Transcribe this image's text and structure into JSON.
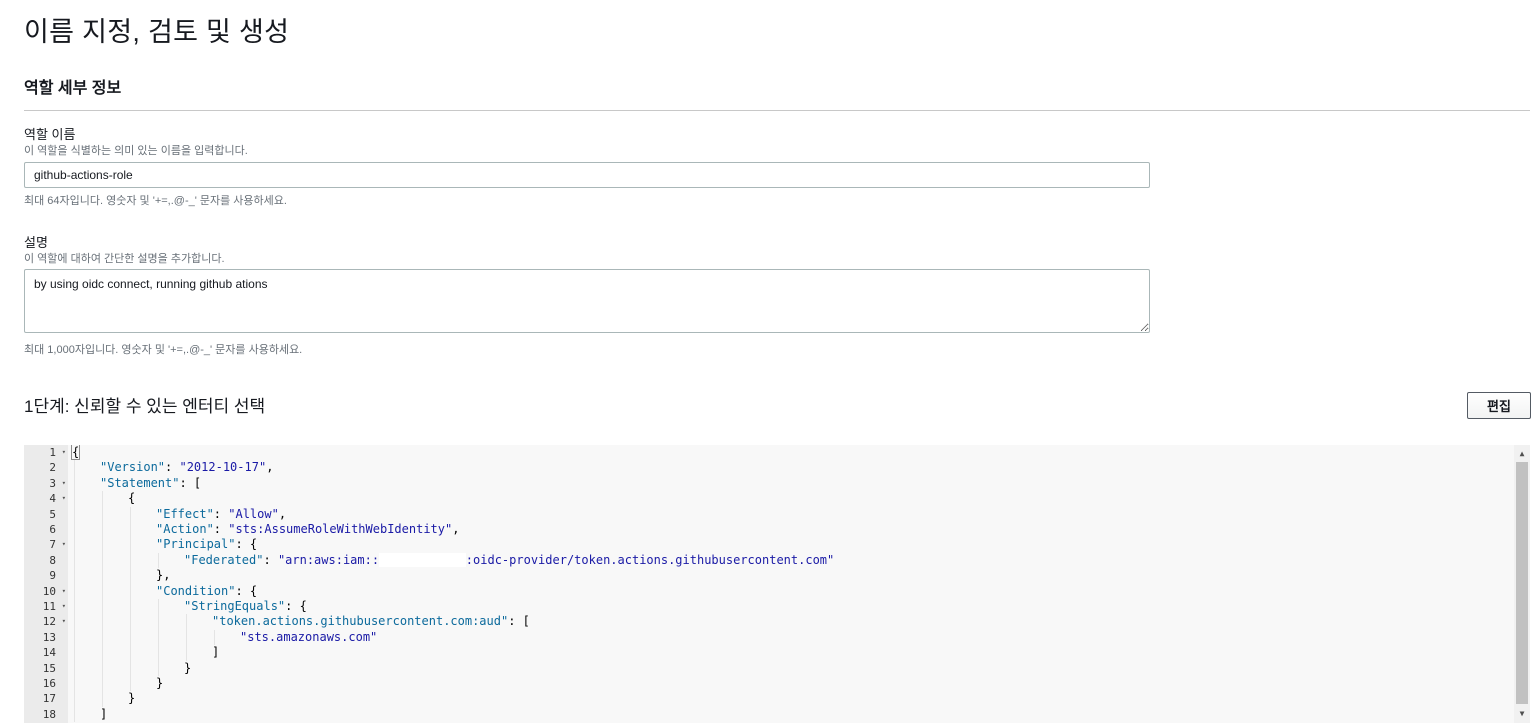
{
  "page": {
    "title": "이름 지정, 검토 및 생성"
  },
  "role_details": {
    "section_title": "역할 세부 정보",
    "name_field": {
      "label": "역할 이름",
      "description": "이 역할을 식별하는 의미 있는 이름을 입력합니다.",
      "value": "github-actions-role",
      "hint": "최대 64자입니다. 영숫자 및 '+=,.@-_' 문자를 사용하세요."
    },
    "description_field": {
      "label": "설명",
      "description": "이 역할에 대하여 간단한 설명을 추가합니다.",
      "value": "by using oidc connect, running github ations",
      "hint": "최대 1,000자입니다. 영숫자 및 '+=,.@-_' 문자를 사용하세요."
    }
  },
  "step1": {
    "title": "1단계: 신뢰할 수 있는 엔터티 선택",
    "edit_label": "편집"
  },
  "editor": {
    "fold_glyph": "▾",
    "scroll_up_glyph": "▲",
    "scroll_down_glyph": "▼",
    "lines": [
      {
        "num": "1",
        "fold": true,
        "indent": 0,
        "tokens": [
          {
            "t": "punc",
            "v": "{"
          }
        ]
      },
      {
        "num": "2",
        "fold": false,
        "indent": 1,
        "tokens": [
          {
            "t": "key",
            "v": "\"Version\""
          },
          {
            "t": "punc",
            "v": ": "
          },
          {
            "t": "str",
            "v": "\"2012-10-17\""
          },
          {
            "t": "punc",
            "v": ","
          }
        ]
      },
      {
        "num": "3",
        "fold": true,
        "indent": 1,
        "tokens": [
          {
            "t": "key",
            "v": "\"Statement\""
          },
          {
            "t": "punc",
            "v": ": ["
          }
        ]
      },
      {
        "num": "4",
        "fold": true,
        "indent": 2,
        "tokens": [
          {
            "t": "punc",
            "v": "{"
          }
        ]
      },
      {
        "num": "5",
        "fold": false,
        "indent": 3,
        "tokens": [
          {
            "t": "key",
            "v": "\"Effect\""
          },
          {
            "t": "punc",
            "v": ": "
          },
          {
            "t": "str",
            "v": "\"Allow\""
          },
          {
            "t": "punc",
            "v": ","
          }
        ]
      },
      {
        "num": "6",
        "fold": false,
        "indent": 3,
        "tokens": [
          {
            "t": "key",
            "v": "\"Action\""
          },
          {
            "t": "punc",
            "v": ": "
          },
          {
            "t": "str",
            "v": "\"sts:AssumeRoleWithWebIdentity\""
          },
          {
            "t": "punc",
            "v": ","
          }
        ]
      },
      {
        "num": "7",
        "fold": true,
        "indent": 3,
        "tokens": [
          {
            "t": "key",
            "v": "\"Principal\""
          },
          {
            "t": "punc",
            "v": ": {"
          }
        ]
      },
      {
        "num": "8",
        "fold": false,
        "indent": 4,
        "tokens": [
          {
            "t": "key",
            "v": "\"Federated\""
          },
          {
            "t": "punc",
            "v": ": "
          },
          {
            "t": "str",
            "v": "\"arn:aws:iam::"
          },
          {
            "t": "redact",
            "v": "            "
          },
          {
            "t": "str",
            "v": ":oidc-provider/token.actions.githubusercontent.com\""
          }
        ]
      },
      {
        "num": "9",
        "fold": false,
        "indent": 3,
        "tokens": [
          {
            "t": "punc",
            "v": "},"
          }
        ]
      },
      {
        "num": "10",
        "fold": true,
        "indent": 3,
        "tokens": [
          {
            "t": "key",
            "v": "\"Condition\""
          },
          {
            "t": "punc",
            "v": ": {"
          }
        ]
      },
      {
        "num": "11",
        "fold": true,
        "indent": 4,
        "tokens": [
          {
            "t": "key",
            "v": "\"StringEquals\""
          },
          {
            "t": "punc",
            "v": ": {"
          }
        ]
      },
      {
        "num": "12",
        "fold": true,
        "indent": 5,
        "tokens": [
          {
            "t": "key",
            "v": "\"token.actions.githubusercontent.com:aud\""
          },
          {
            "t": "punc",
            "v": ": ["
          }
        ]
      },
      {
        "num": "13",
        "fold": false,
        "indent": 6,
        "tokens": [
          {
            "t": "str",
            "v": "\"sts.amazonaws.com\""
          }
        ]
      },
      {
        "num": "14",
        "fold": false,
        "indent": 5,
        "tokens": [
          {
            "t": "punc",
            "v": "]"
          }
        ]
      },
      {
        "num": "15",
        "fold": false,
        "indent": 4,
        "tokens": [
          {
            "t": "punc",
            "v": "}"
          }
        ]
      },
      {
        "num": "16",
        "fold": false,
        "indent": 3,
        "tokens": [
          {
            "t": "punc",
            "v": "}"
          }
        ]
      },
      {
        "num": "17",
        "fold": false,
        "indent": 2,
        "tokens": [
          {
            "t": "punc",
            "v": "}"
          }
        ]
      },
      {
        "num": "18",
        "fold": false,
        "indent": 1,
        "tokens": [
          {
            "t": "punc",
            "v": "]"
          }
        ]
      }
    ]
  }
}
